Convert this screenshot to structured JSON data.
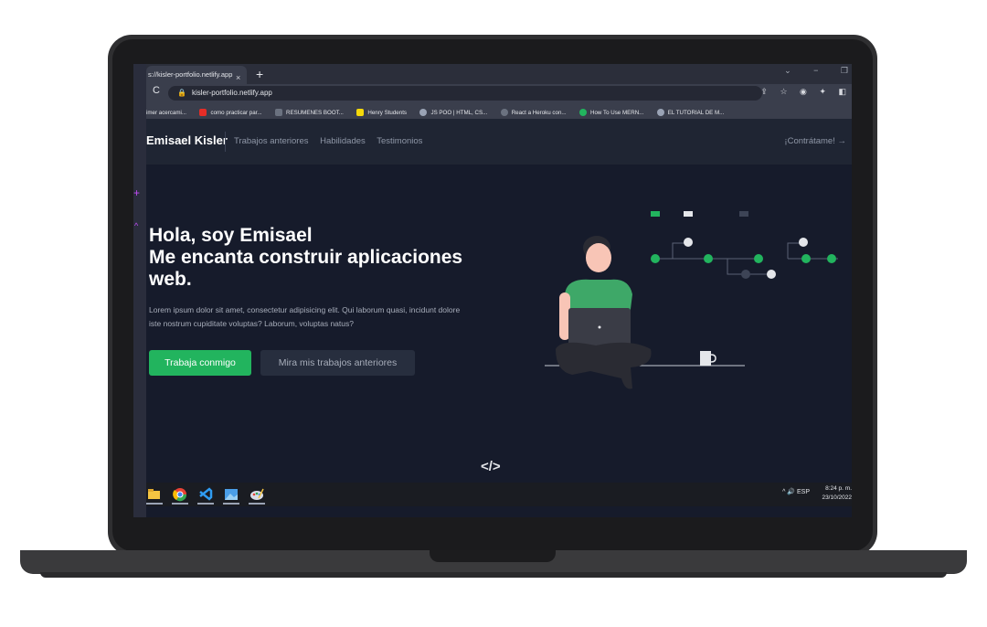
{
  "browser": {
    "tab_title": "s://kisler-portfolio.netlify.app",
    "tab_close": "×",
    "new_tab": "+",
    "window_controls": [
      "⌄",
      "−",
      "❐"
    ],
    "reload_icon": "C",
    "url": "kisler-portfolio.netlify.app",
    "bookmarks": [
      {
        "label": "imer acercami...",
        "color": "#3a3e4c"
      },
      {
        "label": "como practicar par...",
        "color": "#e52d27"
      },
      {
        "label": "RESUMENES BOOT...",
        "color": "#6b7280"
      },
      {
        "label": "Henry Students",
        "color": "#f5d90a"
      },
      {
        "label": "JS POO | HTML, CS...",
        "color": "#9aa3b5"
      },
      {
        "label": "React a Heroku con...",
        "color": "#6b7280"
      },
      {
        "label": "How To Use MERN...",
        "color": "#22b45e"
      },
      {
        "label": "EL TUTORIAL DE M...",
        "color": "#9aa3b5"
      }
    ]
  },
  "site": {
    "brand": "Emisael Kisler",
    "nav": [
      "Trabajos anteriores",
      "Habilidades",
      "Testimonios"
    ],
    "hire": "¡Contrátame! →",
    "hero_line1": "Hola, soy Emisael",
    "hero_line2": "Me encanta construir aplicaciones web.",
    "hero_desc": "Lorem ipsum dolor sit amet, consectetur adipisicing elit. Qui laborum quasi, incidunt dolore iste nostrum cupiditate voluptas? Laborum, voluptas natus?",
    "btn_primary": "Trabaja conmigo",
    "btn_secondary": "Mira mis trabajos anteriores",
    "code_icon": "</>",
    "accent_color": "#22b45e"
  },
  "taskbar": {
    "apps": [
      "file-explorer-icon",
      "chrome-icon",
      "vscode-icon",
      "photos-icon",
      "paint-icon"
    ],
    "tray": "^ 🔊 ESP",
    "time": "8:24 p. m.",
    "date": "23/10/2022"
  }
}
